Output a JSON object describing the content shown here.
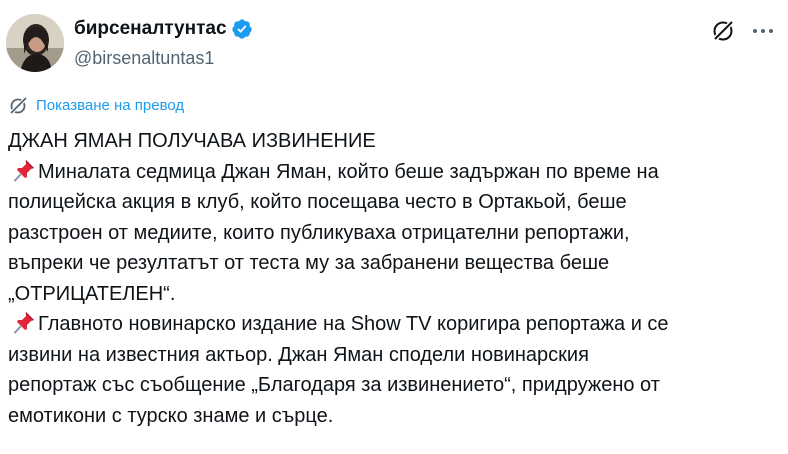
{
  "author": {
    "display_name": "бирсеналтунтас",
    "handle": "@birsenaltuntas1",
    "verified": true
  },
  "translate": {
    "label": "Показване на превод"
  },
  "post": {
    "lines": [
      "ДЖАН ЯМАН ПОЛУЧАВА ИЗВИНЕНИЕ",
      "Миналата седмица Джан Яман, който беше задържан по време на",
      "полицейска акция в клуб, който посещава често в Ортакьой, беше",
      "разстроен от медиите, които публикуваха отрицателни репортажи,",
      "въпреки че резултатът от теста му за забранени вещества беше",
      "„ОТРИЦАТЕЛЕН“.",
      "Главното новинарско издание на Show TV коригира репортажа и се",
      "извини на известния актьор. Джан Яман сподели новинарския",
      "репортаж със съобщение „Благодаря за извинението“, придружено от",
      "емотикони с турско знаме и сърце."
    ]
  },
  "icons": {
    "verified": "verified-badge-icon",
    "grok": "grok-icon",
    "more": "more-options-icon",
    "translate": "translate-icon",
    "pin": "pushpin-emoji-icon"
  },
  "colors": {
    "accent": "#1d9bf0",
    "secondary_text": "#536471",
    "primary_text": "#0f1419",
    "pin_red": "#e0243a"
  }
}
